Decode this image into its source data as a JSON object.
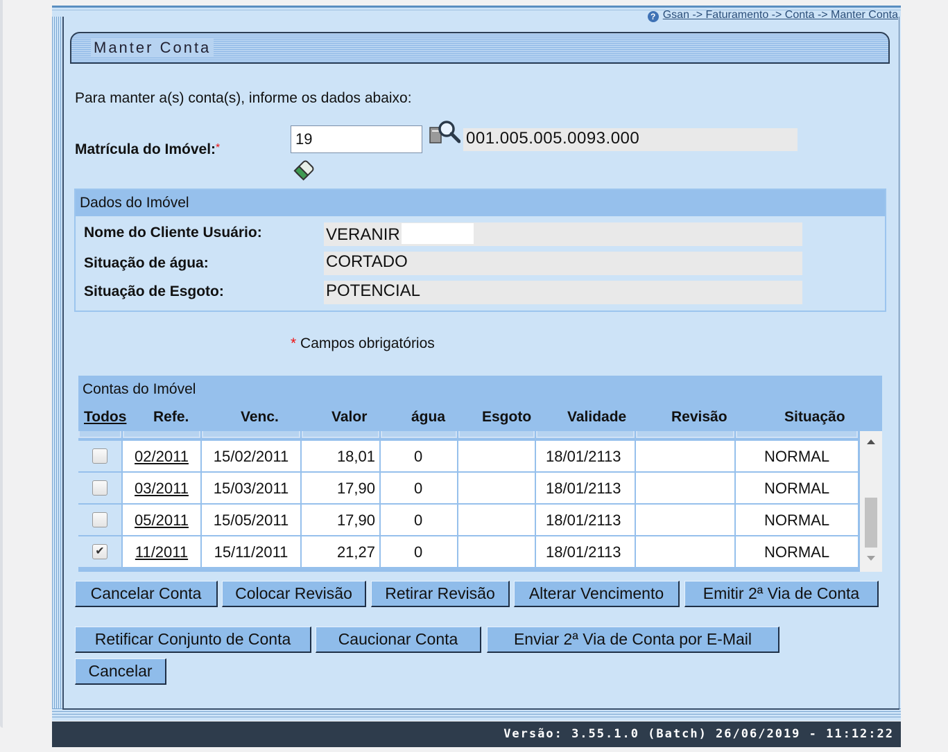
{
  "breadcrumb": "Gsan -> Faturamento -> Conta -> Manter Conta",
  "title": "Manter Conta",
  "intro": "Para manter a(s) conta(s), informe os dados abaixo:",
  "matricula": {
    "label": "Matrícula do Imóvel:",
    "required_marker": "*",
    "value": "19",
    "code": "001.005.005.0093.000"
  },
  "dados": {
    "header": "Dados do Imóvel",
    "rows": [
      {
        "label": "Nome do Cliente Usuário:",
        "value": "VERANIR"
      },
      {
        "label": "Situação de água:",
        "value": "CORTADO"
      },
      {
        "label": "Situação de Esgoto:",
        "value": "POTENCIAL"
      }
    ]
  },
  "required_note": {
    "star": "*",
    "text": " Campos obrigatórios"
  },
  "contas": {
    "header": "Contas do Imóvel",
    "columns": [
      "Todos",
      "Refe.",
      "Venc.",
      "Valor",
      "água",
      "Esgoto",
      "Validade",
      "Revisão",
      "Situação"
    ],
    "rows": [
      {
        "checked": false,
        "refe": "02/2011",
        "venc": "15/02/2011",
        "valor": "18,01",
        "agua": "0",
        "esgoto": "",
        "validade": "18/01/2113",
        "revisao": "",
        "situacao": "NORMAL"
      },
      {
        "checked": false,
        "refe": "03/2011",
        "venc": "15/03/2011",
        "valor": "17,90",
        "agua": "0",
        "esgoto": "",
        "validade": "18/01/2113",
        "revisao": "",
        "situacao": "NORMAL"
      },
      {
        "checked": false,
        "refe": "05/2011",
        "venc": "15/05/2011",
        "valor": "17,90",
        "agua": "0",
        "esgoto": "",
        "validade": "18/01/2113",
        "revisao": "",
        "situacao": "NORMAL"
      },
      {
        "checked": true,
        "refe": "11/2011",
        "venc": "15/11/2011",
        "valor": "21,27",
        "agua": "0",
        "esgoto": "",
        "validade": "18/01/2113",
        "revisao": "",
        "situacao": "NORMAL"
      }
    ]
  },
  "buttons": {
    "cancelar_conta": "Cancelar Conta",
    "colocar_revisao": "Colocar Revisão",
    "retirar_revisao": "Retirar Revisão",
    "alterar_vencimento": "Alterar Vencimento",
    "emitir_2via": "Emitir 2ª Via de Conta",
    "retificar": "Retificar Conjunto de Conta",
    "caucionar": "Caucionar Conta",
    "enviar_email": "Enviar 2ª Via de Conta por E-Mail",
    "cancelar": "Cancelar"
  },
  "footer": "Versão: 3.55.1.0 (Batch) 26/06/2019 - 11:12:22",
  "icons": {
    "help": "help-icon",
    "search": "search-icon",
    "eraser": "eraser-icon",
    "checkmark": "✔"
  },
  "colors": {
    "panel": "#cde3f7",
    "header": "#96c0ec",
    "button": "#8fbcea",
    "footer": "#2e3c4c",
    "required": "#e11111"
  }
}
